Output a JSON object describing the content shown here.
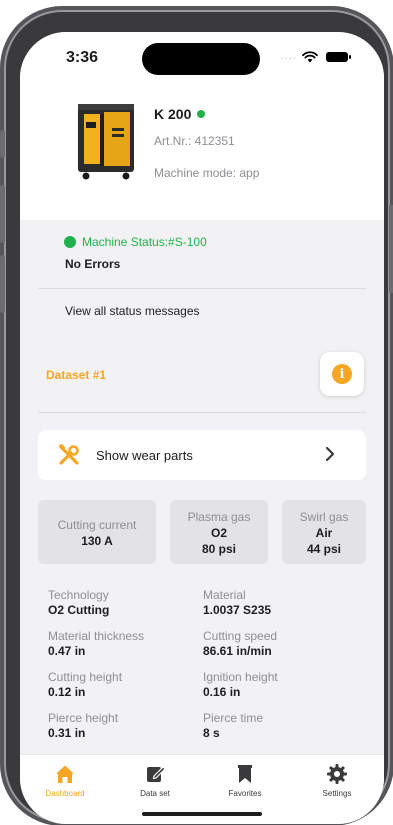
{
  "status_bar": {
    "time": "3:36",
    "dots": "...."
  },
  "machine": {
    "name": "K 200",
    "art_nr": "Art.Nr.: 412351",
    "mode": "Machine mode: app",
    "online_color": "#22b14c"
  },
  "status": {
    "line": "Machine Status:#S-100",
    "errors": "No Errors",
    "view_all": "View all status messages"
  },
  "dataset": {
    "title": "Dataset #1",
    "info_icon": "i",
    "wear_parts_label": "Show wear parts",
    "tiles": [
      {
        "label": "Cutting current",
        "value": "130 A"
      },
      {
        "label": "Plasma gas",
        "value": "O2",
        "value2": "80 psi"
      },
      {
        "label": "Swirl gas",
        "value": "Air",
        "value2": "44 psi"
      }
    ],
    "params": [
      {
        "label": "Technology",
        "value": "O2 Cutting"
      },
      {
        "label": "Material",
        "value": "1.0037 S235"
      },
      {
        "label": "Material thickness",
        "value": "0.47 in"
      },
      {
        "label": "Cutting speed",
        "value": "86.61 in/min"
      },
      {
        "label": "Cutting height",
        "value": "0.12 in"
      },
      {
        "label": "Ignition height",
        "value": "0.16 in"
      },
      {
        "label": "Pierce height",
        "value": "0.31 in"
      },
      {
        "label": "Pierce time",
        "value": "8 s"
      }
    ]
  },
  "tabs": [
    {
      "label": "Dashboard",
      "icon": "home-icon",
      "active": true
    },
    {
      "label": "Data set",
      "icon": "edit-icon",
      "active": false
    },
    {
      "label": "Favorites",
      "icon": "bookmark-icon",
      "active": false
    },
    {
      "label": "Settings",
      "icon": "gear-icon",
      "active": false
    }
  ],
  "colors": {
    "accent": "#f5a623",
    "success": "#22b14c",
    "card_bg": "#f2f2f4",
    "tile_bg": "#e3e3e6"
  }
}
